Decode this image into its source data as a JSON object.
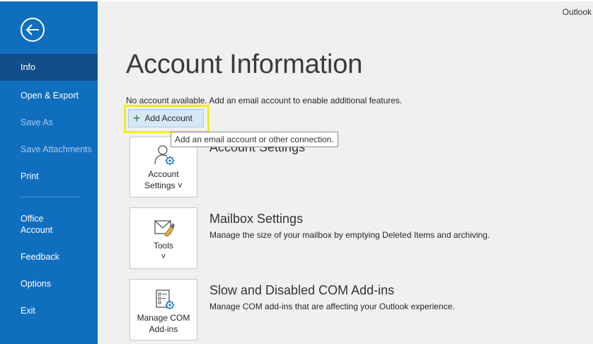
{
  "app": {
    "name": "Outlook"
  },
  "sidebar": {
    "items": [
      {
        "label": "Info",
        "state": "active"
      },
      {
        "label": "Open & Export",
        "state": "normal"
      },
      {
        "label": "Save As",
        "state": "disabled"
      },
      {
        "label": "Save Attachments",
        "state": "disabled"
      },
      {
        "label": "Print",
        "state": "normal"
      },
      {
        "label": "Office",
        "label2": "Account",
        "state": "normal"
      },
      {
        "label": "Feedback",
        "state": "normal"
      },
      {
        "label": "Options",
        "state": "normal"
      },
      {
        "label": "Exit",
        "state": "normal"
      }
    ],
    "back_icon": "back-arrow-icon"
  },
  "main": {
    "title": "Account Information",
    "intro": "No account available. Add an email account to enable additional features.",
    "add_account_label": "Add Account",
    "add_account_tooltip": "Add an email account or other connection.",
    "sections": [
      {
        "tile_label_1": "Account",
        "tile_label_2": "Settings ˅",
        "title": "Account Settings",
        "description": "",
        "icon": "account-settings-icon"
      },
      {
        "tile_label_1": "Tools",
        "tile_label_2": "˅",
        "title": "Mailbox Settings",
        "description": "Manage the size of your mailbox by emptying Deleted Items and archiving.",
        "icon": "mailbox-tools-icon"
      },
      {
        "tile_label_1": "Manage COM",
        "tile_label_2": "Add-ins",
        "title": "Slow and Disabled COM Add-ins",
        "description": "Manage COM add-ins that are affecting your Outlook experience.",
        "icon": "com-addins-icon"
      }
    ]
  },
  "colors": {
    "sidebar": "#106ebe",
    "sidebar_active": "#124e8b",
    "highlight": "#f2ec1c",
    "add_button_bg": "#d6e8f7"
  }
}
